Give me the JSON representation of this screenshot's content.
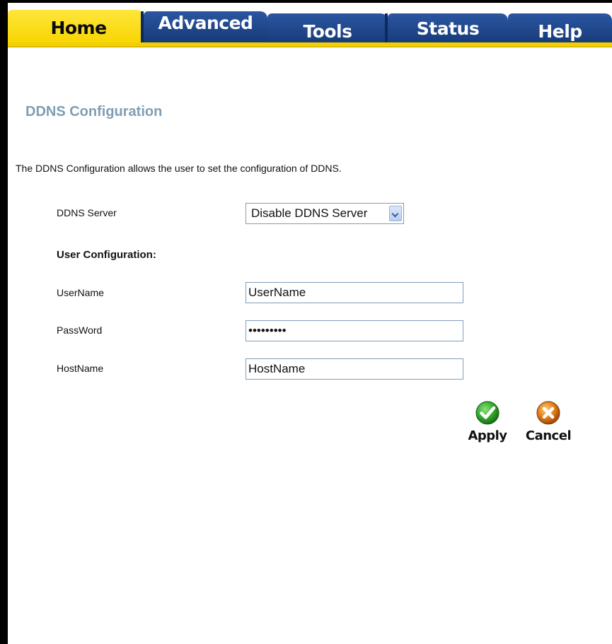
{
  "tabs": {
    "home": "Home",
    "advanced": "Advanced",
    "tools": "Tools",
    "status": "Status",
    "help": "Help",
    "active": "Home"
  },
  "page": {
    "title": "DDNS Configuration",
    "description": "The DDNS Configuration allows the user to set the configuration of DDNS."
  },
  "form": {
    "ddns_server_label": "DDNS Server",
    "ddns_server_value": "Disable DDNS Server",
    "user_config_label": "User Configuration:",
    "username_label": "UserName",
    "username_value": "UserName",
    "password_label": "PassWord",
    "password_value": "PassWord!",
    "hostname_label": "HostName",
    "hostname_value": "HostName"
  },
  "actions": {
    "apply_label": "Apply",
    "cancel_label": "Cancel"
  },
  "colors": {
    "active_tab": "#f7d400",
    "inactive_tab": "#1f4a8e",
    "title": "#7f9eb5",
    "apply_icon": "#2fa82a",
    "cancel_icon": "#e07a16"
  },
  "icons": {
    "apply": "check-circle-icon",
    "cancel": "x-circle-icon"
  }
}
